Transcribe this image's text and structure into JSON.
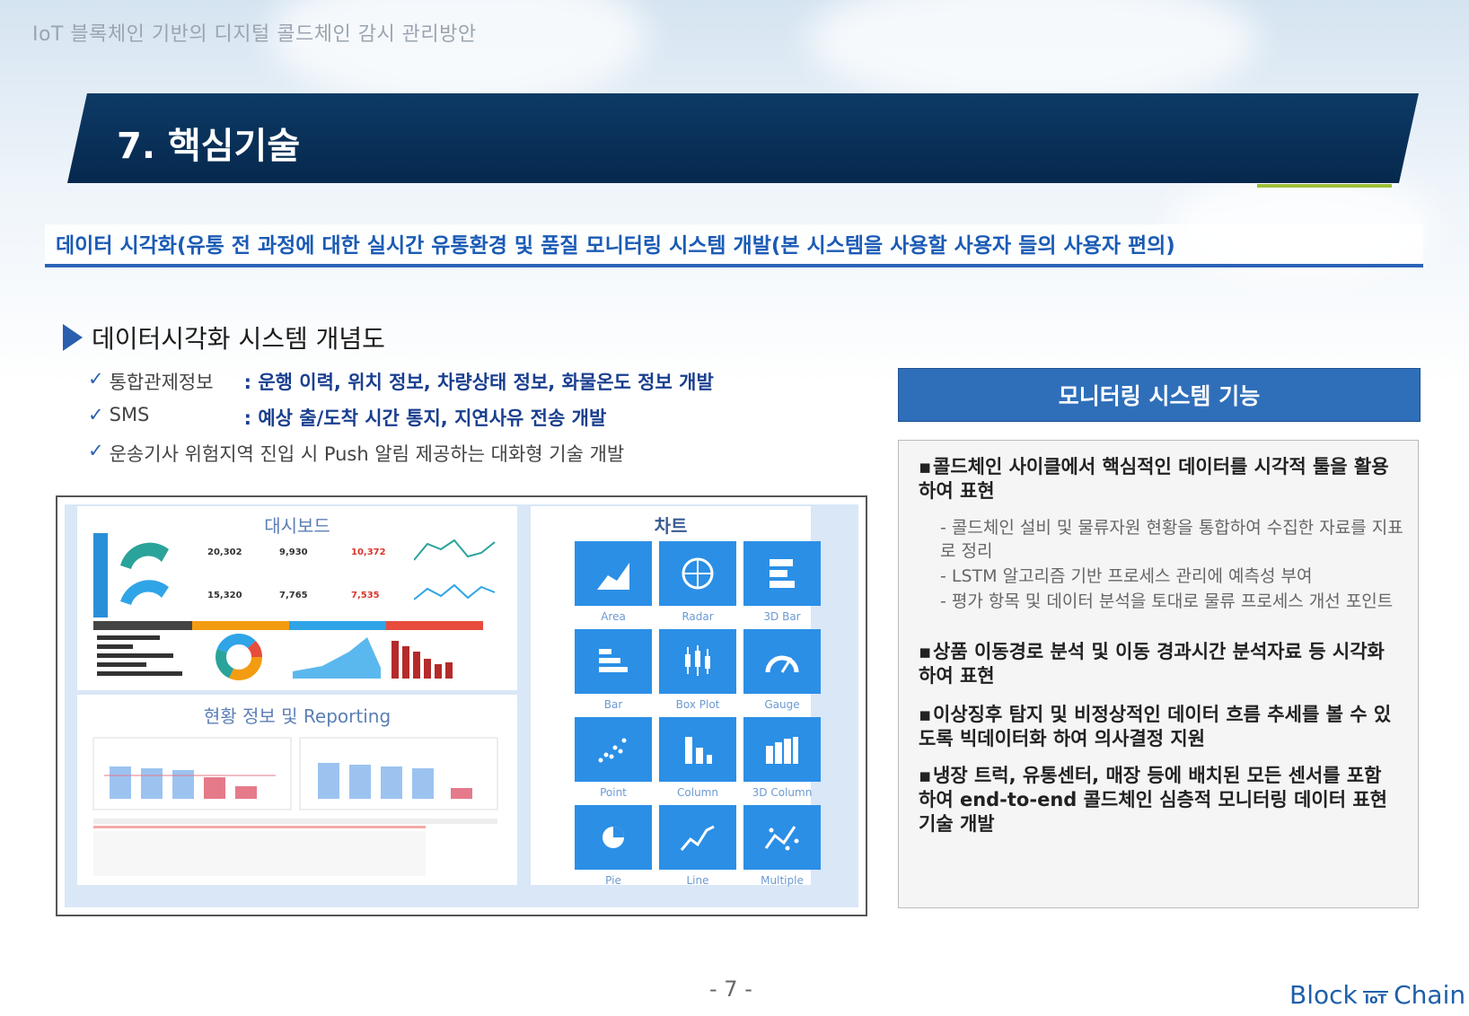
{
  "doc_title": "IoT 블록체인 기반의 디지털 콜드체인 감시 관리방안",
  "section_title": "7. 핵심기술",
  "subtitle": "데이터 시각화(유통 전 과정에 대한 실시간 유통환경 및 품질 모니터링 시스템 개발(본 시스템을 사용할 사용자 들의 사용자 편의)",
  "concept": {
    "heading": "데이터시각화 시스템 개념도",
    "checks": [
      {
        "label": "통합관제정보",
        "value": ": 운행 이력, 위치 정보, 차량상태 정보, 화물온도 정보 개발"
      },
      {
        "label": "SMS",
        "value": ": 예상 출/도착 시간 통지, 지연사유 전송 개발"
      },
      {
        "label": "운송기사 위험지역 진입 시 Push 알림 제공하는 대화형 기술 개발",
        "value": ""
      }
    ]
  },
  "dashboard": {
    "title": "대시보드",
    "kpis": [
      {
        "value": "20,302"
      },
      {
        "value": "9,930"
      },
      {
        "value": "10,372"
      },
      {
        "value": "15,320"
      },
      {
        "value": "7,765"
      },
      {
        "value": "7,535"
      }
    ],
    "report_title": "현황 정보 및 Reporting"
  },
  "charts_panel": {
    "title": "차트",
    "tiles": [
      {
        "label": "Area",
        "icon": "area-chart-icon"
      },
      {
        "label": "Radar",
        "icon": "radar-chart-icon"
      },
      {
        "label": "3D Bar",
        "icon": "3d-bar-icon"
      },
      {
        "label": "Bar",
        "icon": "bar-chart-icon"
      },
      {
        "label": "Box Plot",
        "icon": "box-plot-icon"
      },
      {
        "label": "Gauge",
        "icon": "gauge-icon"
      },
      {
        "label": "Point",
        "icon": "point-chart-icon"
      },
      {
        "label": "Column",
        "icon": "column-chart-icon"
      },
      {
        "label": "3D Column",
        "icon": "3d-column-icon"
      },
      {
        "label": "Pie",
        "icon": "pie-chart-icon"
      },
      {
        "label": "Line",
        "icon": "line-chart-icon"
      },
      {
        "label": "Multiple",
        "icon": "multiple-chart-icon"
      }
    ]
  },
  "monitoring": {
    "title": "모니터링 시스템 기능",
    "items": [
      {
        "text": "콜드체인 사이클에서 핵심적인 데이터를 시각적 툴을 활용하여 표현",
        "subs": [
          "콜드체인 설비 및 물류자원 현황을 통합하여 수집한 자료를 지표로 정리",
          "LSTM 알고리즘 기반 프로세스 관리에 예측성 부여",
          "평가 항목 및 데이터 분석을 토대로 물류 프로세스 개선 포인트"
        ]
      },
      {
        "text": "상품 이동경로 분석 및 이동 경과시간 분석자료 등 시각화하여 표현",
        "subs": []
      },
      {
        "text": "이상징후 탐지 및 비정상적인 데이터 흐름 추세를  볼 수 있도록 빅데이터화 하여 의사결정 지원",
        "subs": []
      },
      {
        "text": "냉장 트럭, 유통센터, 매장 등에 배치된 모든 센서를 포함하여 end-to-end 콜드체인 심층적 모니터링 데이터 표현기술 개발",
        "subs": []
      }
    ]
  },
  "page_number": "- 7 -",
  "logo": {
    "left": "Block",
    "mid": "IoT",
    "right": "Chain"
  }
}
